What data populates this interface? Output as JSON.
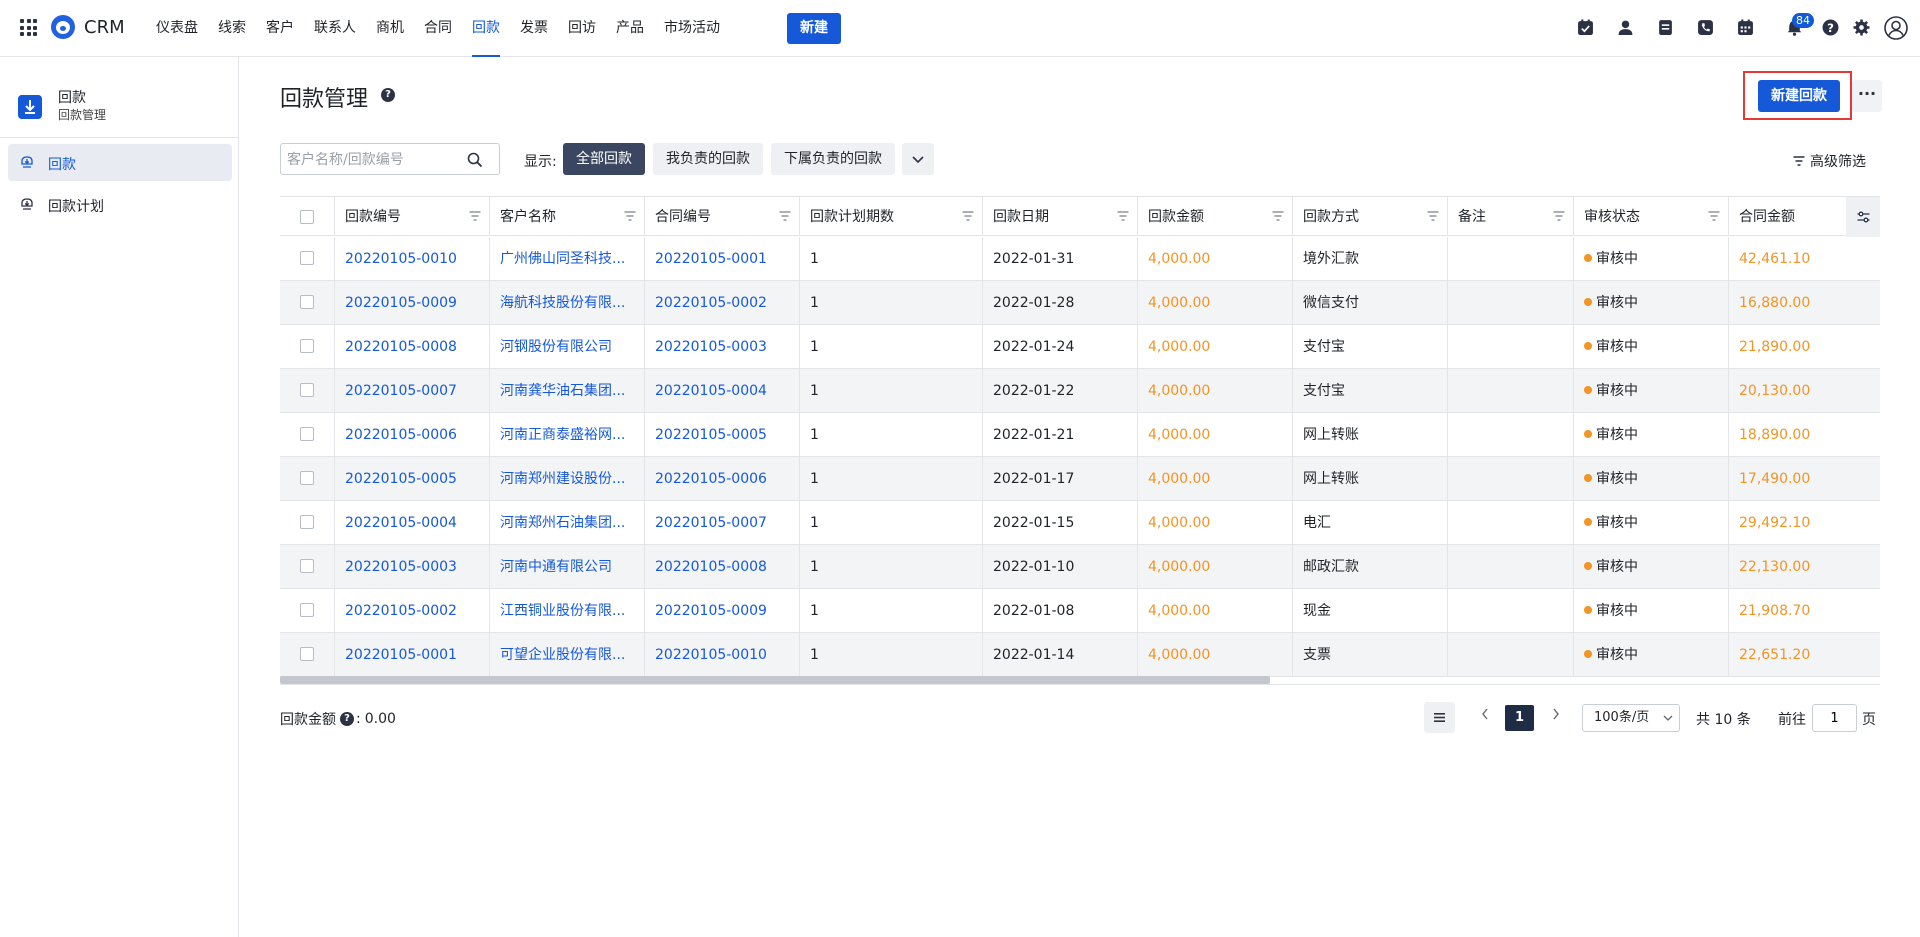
{
  "app": {
    "name": "CRM"
  },
  "nav": {
    "items": [
      "仪表盘",
      "线索",
      "客户",
      "联系人",
      "商机",
      "合同",
      "回款",
      "发票",
      "回访",
      "产品",
      "市场活动"
    ],
    "active_index": 6,
    "new_label": "新建",
    "notification_count": "84"
  },
  "sidebar": {
    "title": "回款",
    "subtitle": "回款管理",
    "items": [
      {
        "label": "回款",
        "active": true
      },
      {
        "label": "回款计划",
        "active": false
      }
    ]
  },
  "page": {
    "title": "回款管理",
    "help_mark": "?",
    "primary_button": "新建回款",
    "more_button": "···"
  },
  "toolbar": {
    "search_placeholder": "客户名称/回款编号",
    "show_label": "显示:",
    "tabs": [
      "全部回款",
      "我负责的回款",
      "下属负责的回款"
    ],
    "active_tab": 0,
    "advanced_filter": "高级筛选"
  },
  "table": {
    "columns": [
      "回款编号",
      "客户名称",
      "合同编号",
      "回款计划期数",
      "回款日期",
      "回款金额",
      "回款方式",
      "备注",
      "审核状态",
      "合同金额"
    ],
    "rows": [
      [
        "20220105-0010",
        "广州佛山同圣科技...",
        "20220105-0001",
        "1",
        "2022-01-31",
        "4,000.00",
        "境外汇款",
        "",
        "审核中",
        "42,461.10"
      ],
      [
        "20220105-0009",
        "海航科技股份有限...",
        "20220105-0002",
        "1",
        "2022-01-28",
        "4,000.00",
        "微信支付",
        "",
        "审核中",
        "16,880.00"
      ],
      [
        "20220105-0008",
        "河钢股份有限公司",
        "20220105-0003",
        "1",
        "2022-01-24",
        "4,000.00",
        "支付宝",
        "",
        "审核中",
        "21,890.00"
      ],
      [
        "20220105-0007",
        "河南龚华油石集团...",
        "20220105-0004",
        "1",
        "2022-01-22",
        "4,000.00",
        "支付宝",
        "",
        "审核中",
        "20,130.00"
      ],
      [
        "20220105-0006",
        "河南正商泰盛裕网...",
        "20220105-0005",
        "1",
        "2022-01-21",
        "4,000.00",
        "网上转账",
        "",
        "审核中",
        "18,890.00"
      ],
      [
        "20220105-0005",
        "河南郑州建设股份...",
        "20220105-0006",
        "1",
        "2022-01-17",
        "4,000.00",
        "网上转账",
        "",
        "审核中",
        "17,490.00"
      ],
      [
        "20220105-0004",
        "河南郑州石油集团...",
        "20220105-0007",
        "1",
        "2022-01-15",
        "4,000.00",
        "电汇",
        "",
        "审核中",
        "29,492.10"
      ],
      [
        "20220105-0003",
        "河南中通有限公司",
        "20220105-0008",
        "1",
        "2022-01-10",
        "4,000.00",
        "邮政汇款",
        "",
        "审核中",
        "22,130.00"
      ],
      [
        "20220105-0002",
        "江西铜业股份有限...",
        "20220105-0009",
        "1",
        "2022-01-08",
        "4,000.00",
        "现金",
        "",
        "审核中",
        "21,908.70"
      ],
      [
        "20220105-0001",
        "可望企业股份有限...",
        "20220105-0010",
        "1",
        "2022-01-14",
        "4,000.00",
        "支票",
        "",
        "审核中",
        "22,651.20"
      ]
    ]
  },
  "footer": {
    "sum_label": "回款金额",
    "sum_suffix": ":",
    "sum_value": "0.00",
    "current_page": "1",
    "page_size": "100条/页",
    "total": "共 10 条",
    "goto_label": "前往",
    "goto_value": "1",
    "page_unit": "页"
  },
  "colors": {
    "primary": "#1559d8",
    "amount": "#f39423",
    "status_dot": "#f39423",
    "highlight": "#e53935"
  }
}
